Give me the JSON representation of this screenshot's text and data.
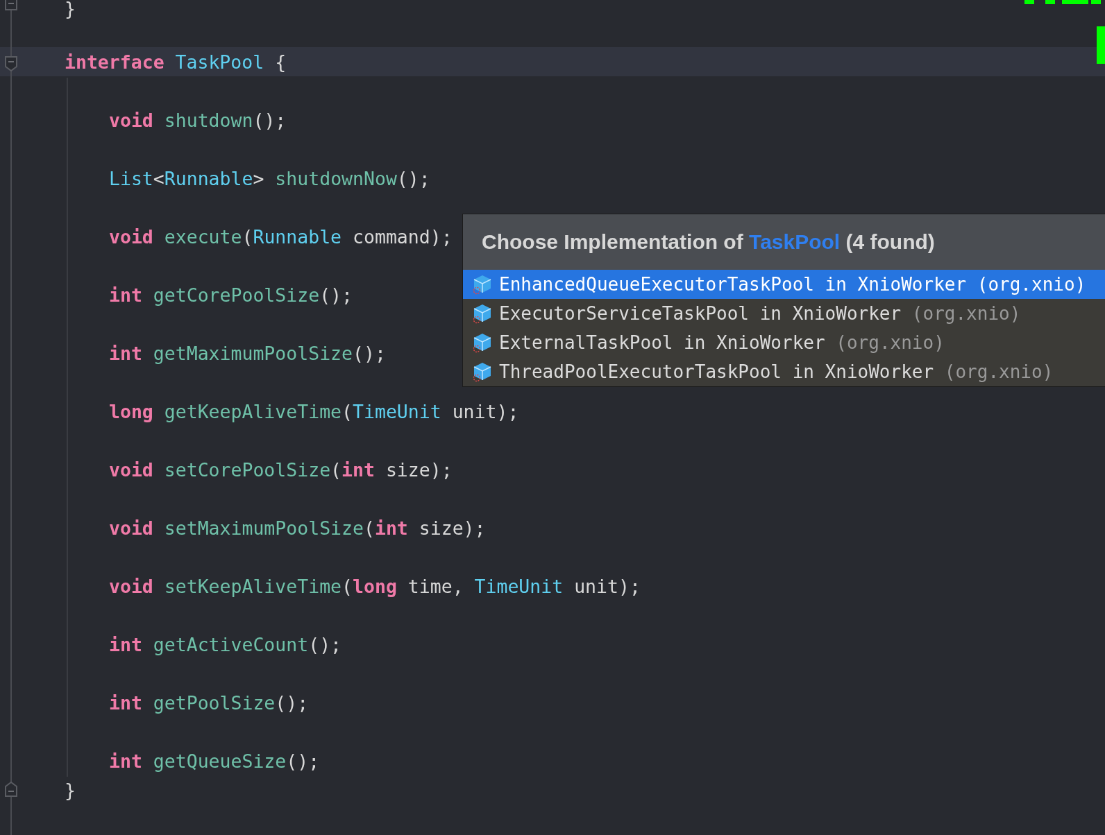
{
  "editor": {
    "prev_block_end": "}",
    "interface": {
      "current_line": true,
      "tokens": [
        {
          "kind": "keyword",
          "text": "interface "
        },
        {
          "kind": "type",
          "text": "TaskPool"
        },
        {
          "kind": "plain",
          "text": " {"
        }
      ],
      "members": [
        {
          "tokens": [
            {
              "kind": "keyword",
              "text": "void "
            },
            {
              "kind": "method",
              "text": "shutdown"
            },
            {
              "kind": "plain",
              "text": "();"
            }
          ]
        },
        {
          "tokens": [
            {
              "kind": "type",
              "text": "List"
            },
            {
              "kind": "plain",
              "text": "<"
            },
            {
              "kind": "type",
              "text": "Runnable"
            },
            {
              "kind": "plain",
              "text": "> "
            },
            {
              "kind": "method",
              "text": "shutdownNow"
            },
            {
              "kind": "plain",
              "text": "();"
            }
          ]
        },
        {
          "tokens": [
            {
              "kind": "keyword",
              "text": "void "
            },
            {
              "kind": "method",
              "text": "execute"
            },
            {
              "kind": "plain",
              "text": "("
            },
            {
              "kind": "type",
              "text": "Runnable"
            },
            {
              "kind": "plain",
              "text": " command);"
            }
          ]
        },
        {
          "tokens": [
            {
              "kind": "keyword",
              "text": "int "
            },
            {
              "kind": "method",
              "text": "getCorePoolSize"
            },
            {
              "kind": "plain",
              "text": "();"
            }
          ]
        },
        {
          "tokens": [
            {
              "kind": "keyword",
              "text": "int "
            },
            {
              "kind": "method",
              "text": "getMaximumPoolSize"
            },
            {
              "kind": "plain",
              "text": "();"
            }
          ]
        },
        {
          "tokens": [
            {
              "kind": "keyword",
              "text": "long "
            },
            {
              "kind": "method",
              "text": "getKeepAliveTime"
            },
            {
              "kind": "plain",
              "text": "("
            },
            {
              "kind": "type",
              "text": "TimeUnit"
            },
            {
              "kind": "plain",
              "text": " unit);"
            }
          ]
        },
        {
          "tokens": [
            {
              "kind": "keyword",
              "text": "void "
            },
            {
              "kind": "method",
              "text": "setCorePoolSize"
            },
            {
              "kind": "plain",
              "text": "("
            },
            {
              "kind": "keyword",
              "text": "int"
            },
            {
              "kind": "plain",
              "text": " size);"
            }
          ]
        },
        {
          "tokens": [
            {
              "kind": "keyword",
              "text": "void "
            },
            {
              "kind": "method",
              "text": "setMaximumPoolSize"
            },
            {
              "kind": "plain",
              "text": "("
            },
            {
              "kind": "keyword",
              "text": "int"
            },
            {
              "kind": "plain",
              "text": " size);"
            }
          ]
        },
        {
          "tokens": [
            {
              "kind": "keyword",
              "text": "void "
            },
            {
              "kind": "method",
              "text": "setKeepAliveTime"
            },
            {
              "kind": "plain",
              "text": "("
            },
            {
              "kind": "keyword",
              "text": "long"
            },
            {
              "kind": "plain",
              "text": " time, "
            },
            {
              "kind": "type",
              "text": "TimeUnit"
            },
            {
              "kind": "plain",
              "text": " unit);"
            }
          ]
        },
        {
          "tokens": [
            {
              "kind": "keyword",
              "text": "int "
            },
            {
              "kind": "method",
              "text": "getActiveCount"
            },
            {
              "kind": "plain",
              "text": "();"
            }
          ]
        },
        {
          "tokens": [
            {
              "kind": "keyword",
              "text": "int "
            },
            {
              "kind": "method",
              "text": "getPoolSize"
            },
            {
              "kind": "plain",
              "text": "();"
            }
          ]
        },
        {
          "tokens": [
            {
              "kind": "keyword",
              "text": "int "
            },
            {
              "kind": "method",
              "text": "getQueueSize"
            },
            {
              "kind": "plain",
              "text": "();"
            }
          ]
        }
      ],
      "closing": "}"
    }
  },
  "popup": {
    "title": [
      {
        "kind": "plain",
        "text": "Choose Implementation of "
      },
      {
        "kind": "class",
        "text": "TaskPool"
      },
      {
        "kind": "plain",
        "text": " (4 found)"
      }
    ],
    "items": [
      {
        "name": "EnhancedQueueExecutorTaskPool in XnioWorker",
        "package": "(org.xnio)",
        "selected": true
      },
      {
        "name": "ExecutorServiceTaskPool in XnioWorker",
        "package": "(org.xnio)",
        "selected": false
      },
      {
        "name": "ExternalTaskPool in XnioWorker",
        "package": "(org.xnio)",
        "selected": false
      },
      {
        "name": "ThreadPoolExecutorTaskPool in XnioWorker",
        "package": "(org.xnio)",
        "selected": false
      }
    ]
  }
}
